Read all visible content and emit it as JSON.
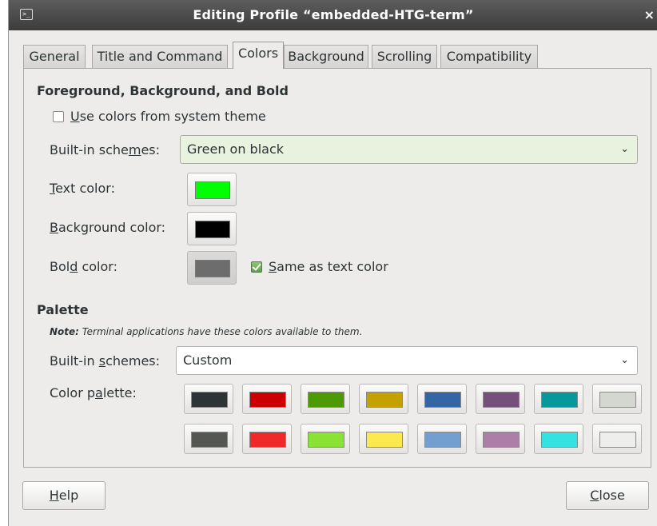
{
  "window": {
    "title": "Editing Profile “embedded-HTG-term”",
    "app_icon": ">_",
    "close_glyph": "×"
  },
  "tabs": [
    {
      "label": "General"
    },
    {
      "label": "Title and Command"
    },
    {
      "label": "Colors",
      "active": true
    },
    {
      "label": "Background"
    },
    {
      "label": "Scrolling"
    },
    {
      "label": "Compatibility"
    }
  ],
  "foreground": {
    "section_title": "Foreground, Background, and Bold",
    "use_system_colors": {
      "label_ul": "U",
      "label_rest": "se colors from system theme",
      "checked": false
    },
    "builtin_schemes": {
      "label_a": "Built-in sche",
      "label_ul": "m",
      "label_b": "es:",
      "value": "Green on black"
    },
    "text_color": {
      "label_ul": "T",
      "label_rest": "ext color:",
      "color": "#00ff00"
    },
    "background_color": {
      "label_ul": "B",
      "label_rest": "ackground color:",
      "color": "#000000"
    },
    "bold_color": {
      "label_a": "Bol",
      "label_ul": "d",
      "label_b": " color:",
      "color": "#6d6d6d"
    },
    "same_as_text": {
      "label_ul": "S",
      "label_rest": "ame as text color",
      "checked": true
    }
  },
  "palette": {
    "section_title": "Palette",
    "note_bold": "Note:",
    "note_text": " Terminal applications have these colors available to them.",
    "builtin_schemes": {
      "label_a": "Built-in ",
      "label_ul": "s",
      "label_b": "chemes:",
      "value": "Custom"
    },
    "color_palette_label": {
      "label_a": "Color p",
      "label_ul": "a",
      "label_b": "lette:"
    },
    "colors": [
      "#2e3436",
      "#cc0000",
      "#4e9a06",
      "#c4a000",
      "#3465a4",
      "#75507b",
      "#06989a",
      "#d3d7cf",
      "#555753",
      "#ef2929",
      "#8ae234",
      "#fce94f",
      "#729fcf",
      "#ad7fa8",
      "#34e2e2",
      "#eeeeec"
    ]
  },
  "buttons": {
    "help": {
      "label_ul": "H",
      "label_rest": "elp"
    },
    "close": {
      "label_ul": "C",
      "label_rest": "lose"
    }
  },
  "icons": {
    "chevron": "⌄"
  }
}
